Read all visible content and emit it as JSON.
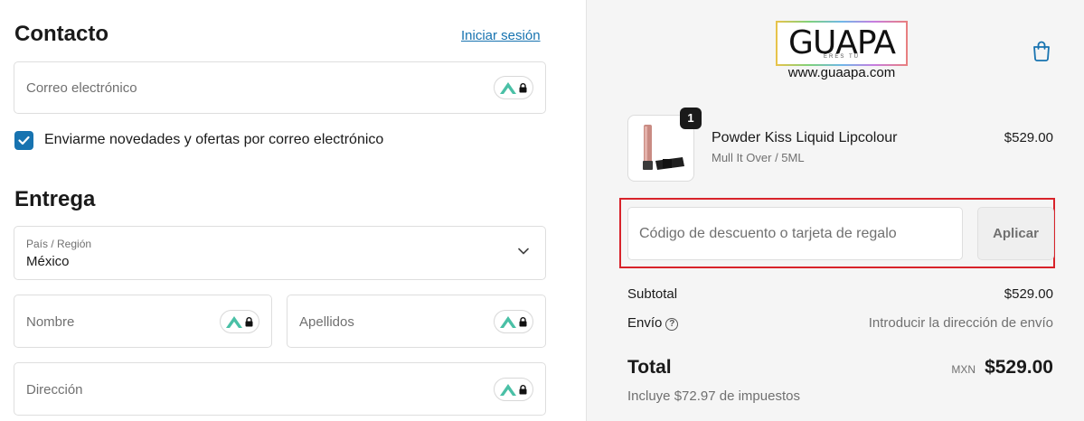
{
  "contact": {
    "title": "Contacto",
    "login_link": "Iniciar sesión",
    "email_placeholder": "Correo electrónico",
    "newsletter_label": "Enviarme novedades y ofertas por correo electrónico",
    "newsletter_checked": true
  },
  "delivery": {
    "title": "Entrega",
    "country_label": "País / Región",
    "country_value": "México",
    "first_name_placeholder": "Nombre",
    "last_name_placeholder": "Apellidos",
    "address_placeholder": "Dirección"
  },
  "brand": {
    "logo_text": "GUAPA",
    "logo_tagline": "ERES TÚ",
    "logo_url": "www.guaapa.com"
  },
  "cart": {
    "item": {
      "quantity": "1",
      "name": "Powder Kiss Liquid Lipcolour",
      "variant": "Mull It Over / 5ML",
      "price": "$529.00"
    },
    "discount_placeholder": "Código de descuento o tarjeta de regalo",
    "apply_label": "Aplicar",
    "subtotal_label": "Subtotal",
    "subtotal_value": "$529.00",
    "shipping_label": "Envío",
    "shipping_value": "Introducir la dirección de envío",
    "total_label": "Total",
    "currency": "MXN",
    "total_value": "$529.00",
    "tax_note": "Incluye $72.97 de impuestos"
  },
  "colors": {
    "accent": "#1773b0",
    "highlight": "#d8232a",
    "nord_teal": "#4ac0a6"
  },
  "icons": [
    "nordpass-lock-icon",
    "checkbox-icon",
    "chevron-down-icon",
    "shopping-bag-icon",
    "help-circle-icon"
  ]
}
